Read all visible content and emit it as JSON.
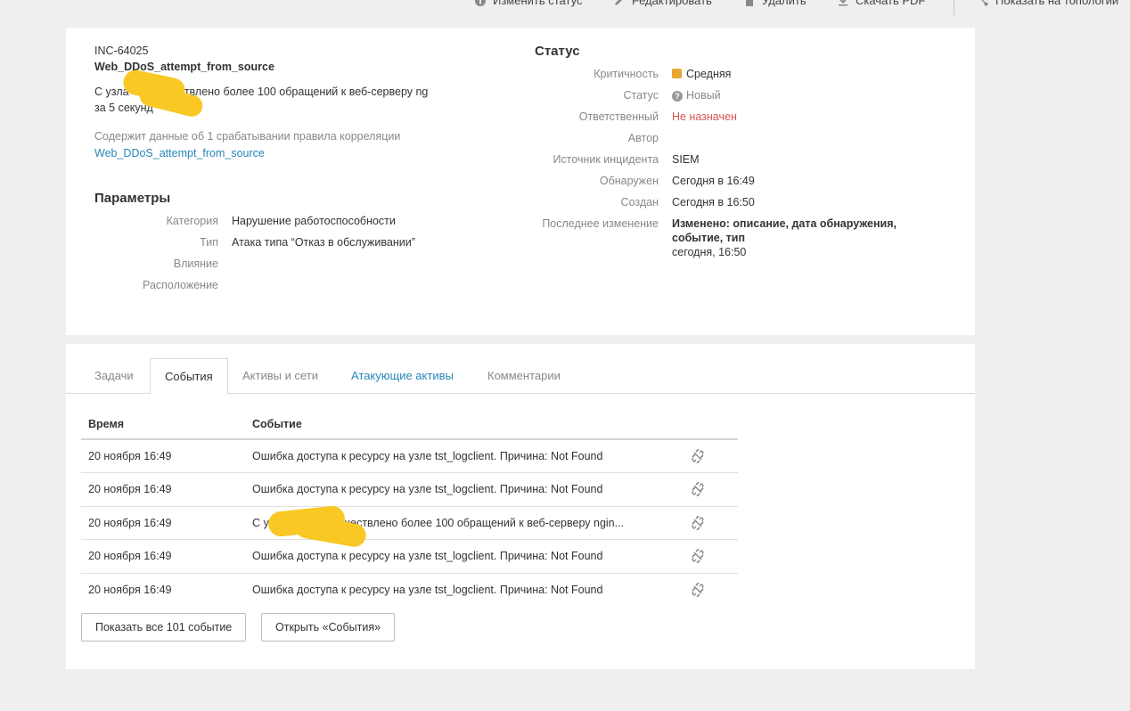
{
  "toolbar": {
    "change_status": "Изменить статус",
    "edit": "Редактировать",
    "delete": "Удалить",
    "download_pdf": "Скачать PDF",
    "show_topology": "Показать на топологии"
  },
  "incident": {
    "id": "INC-64025",
    "name": "Web_DDoS_attempt_from_source",
    "description_line1": "С узла ··· осуществлено более 100 обращений к веб-серверу ng",
    "description_line2": "за 5 секунд",
    "correlation_note": "Содержит данные об 1 срабатывании правила корреляции",
    "correlation_link": "Web_DDoS_attempt_from_source"
  },
  "parameters": {
    "title": "Параметры",
    "rows": [
      {
        "label": "Категория",
        "value": "Нарушение работоспособности"
      },
      {
        "label": "Тип",
        "value": "Атака типа “Отказ в обслуживании”"
      },
      {
        "label": "Влияние",
        "value": ""
      },
      {
        "label": "Расположение",
        "value": ""
      }
    ]
  },
  "status": {
    "title": "Статус",
    "criticality_label": "Критичность",
    "criticality_value": "Средняя",
    "criticality_color": "#e5a735",
    "status_label": "Статус",
    "status_value": "Новый",
    "responsible_label": "Ответственный",
    "responsible_value": "Не назначен",
    "responsible_color": "#d9534f",
    "author_label": "Автор",
    "author_value": "",
    "source_label": "Источник инцидента",
    "source_value": "SIEM",
    "detected_label": "Обнаружен",
    "detected_value": "Сегодня в 16:49",
    "created_label": "Создан",
    "created_value": "Сегодня в 16:50",
    "last_change_label": "Последнее изменение",
    "last_change_line1": "Изменено: описание, дата обнаружения,",
    "last_change_line2": "событие, тип",
    "last_change_time": "сегодня, 16:50"
  },
  "tabs": [
    {
      "label": "Задачи"
    },
    {
      "label": "События"
    },
    {
      "label": "Активы и сети"
    },
    {
      "label": "Атакующие активы"
    },
    {
      "label": "Комментарии"
    }
  ],
  "events": {
    "col_time": "Время",
    "col_event": "Событие",
    "rows": [
      {
        "time": "20 ноября 16:49",
        "event": "Ошибка доступа к ресурсу на узле tst_logclient. Причина: Not Found"
      },
      {
        "time": "20 ноября 16:49",
        "event": "Ошибка доступа к ресурсу на узле tst_logclient. Причина: Not Found"
      },
      {
        "time": "20 ноября 16:49",
        "event": "С у··· ··· ···51 осуществлено более 100 обращений к веб-серверу ngin..."
      },
      {
        "time": "20 ноября 16:49",
        "event": "Ошибка доступа к ресурсу на узле tst_logclient. Причина: Not Found"
      },
      {
        "time": "20 ноября 16:49",
        "event": "Ошибка доступа к ресурсу на узле tst_logclient. Причина: Not Found"
      }
    ],
    "row_icon": "unlink-icon",
    "show_all_button": "Показать все 101 событие",
    "open_events_button": "Открыть «События»"
  }
}
